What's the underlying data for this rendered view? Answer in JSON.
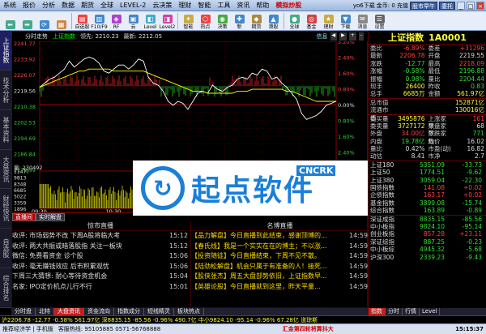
{
  "menu": [
    "系统",
    "报价",
    "分析",
    "数据",
    "期货",
    "全球",
    "LEVEL-2",
    "云决策",
    "理财",
    "智能",
    "工具",
    "资讯",
    "帮助"
  ],
  "menu_hl": "模拟炒股",
  "title_right": {
    "user": "yo6下载",
    "gold": "金币: 0 充值",
    "switch": "股市早午",
    "service": "委托"
  },
  "toolbar": [
    {
      "icon": "⬅",
      "label": ""
    },
    {
      "icon": "➡",
      "label": ""
    },
    {
      "icon": "⟳",
      "label": ""
    },
    {
      "icon": "▦",
      "label": ""
    },
    {
      "icon": "▤",
      "label": "自选股",
      "red": false
    },
    {
      "icon": "▥",
      "label": "F10/F9"
    },
    {
      "icon": "◈",
      "label": "RF"
    },
    {
      "icon": "▣",
      "label": "云"
    },
    {
      "icon": "◧",
      "label": "Level"
    },
    {
      "icon": "◨",
      "label": "Level2"
    },
    {
      "icon": "✦",
      "label": "智能"
    },
    {
      "icon": "⬡",
      "label": "热点"
    },
    {
      "icon": "◉",
      "label": "决策"
    },
    {
      "icon": "✚",
      "label": "新"
    },
    {
      "icon": "◆",
      "label": "期货"
    },
    {
      "icon": "▲",
      "label": "港股"
    },
    {
      "icon": "●",
      "label": "全球"
    },
    {
      "icon": "◎",
      "label": "基金"
    },
    {
      "icon": "★",
      "label": "理财"
    },
    {
      "icon": "▼",
      "label": "下载"
    },
    {
      "icon": "✉",
      "label": "消息"
    },
    {
      "icon": "☰",
      "label": "设置"
    }
  ],
  "sidetabs": [
    "上证指数",
    "技术分析",
    "基本资料",
    "大盘资讯",
    "财经快讯",
    "自选股",
    "综合排名"
  ],
  "chart_info": {
    "label1": "分时走势",
    "label2": "上证指数",
    "label3": "领先: 2210.23",
    "label4": "最新: 2212.05",
    "right": "信息"
  },
  "chart_data": {
    "type": "line",
    "title": "分时走势",
    "y_left_ticks": [
      "2241.77",
      "2233.92",
      "2226.07",
      "2219.56",
      "2210.38",
      "2202.53",
      "2194.69",
      "2186.84",
      "2178.99"
    ],
    "y_right_ticks": [
      "3.20%",
      "2.80%",
      "2.40%",
      "2.00%",
      "1.60%",
      "1.20%",
      "0.80%",
      "0.40%",
      "0.00%",
      "0.40%",
      "0.80%",
      "1.20%",
      "1.60%",
      "2.00%",
      "2.40%",
      "2.80%",
      "3.20%"
    ],
    "x_ticks": [
      "09:30",
      "10:30",
      "11:30",
      "13:00",
      "14:00",
      "15:00"
    ],
    "base": 2219.56,
    "vol_label": "量: 230492",
    "vol_ticks": [
      "11477",
      "9813",
      "8348",
      "6685",
      "5022",
      "3359",
      "1896"
    ],
    "index_line": [
      2219,
      2221,
      2223,
      2224,
      2226,
      2228,
      2232,
      2229,
      2231,
      2233,
      2234,
      2233,
      2231,
      2227,
      2226,
      2228,
      2230,
      2230,
      2228,
      2230,
      2233,
      2232,
      2224,
      2221,
      2220,
      2217,
      2212,
      2210,
      2212,
      2211,
      2208,
      2212,
      2216,
      2217,
      2216,
      2220,
      2218,
      2217,
      2219,
      2220,
      2223,
      2224,
      2223,
      2226,
      2225,
      2228,
      2227,
      2223,
      2224,
      2221,
      2219,
      2216,
      2213,
      2206,
      2203,
      2204,
      2205,
      2207,
      2210,
      2211,
      2212
    ],
    "avg_line": [
      2219,
      2220,
      2221,
      2222,
      2223,
      2224,
      2225,
      2226,
      2227,
      2227,
      2228,
      2228,
      2228,
      2228,
      2228,
      2227,
      2227,
      2227,
      2227,
      2227,
      2227,
      2227,
      2226,
      2225,
      2224,
      2223,
      2222,
      2221,
      2220,
      2219,
      2218,
      2217,
      2217,
      2217,
      2216,
      2216,
      2216,
      2216,
      2216,
      2216,
      2217,
      2217,
      2217,
      2218,
      2218,
      2218,
      2218,
      2218,
      2218,
      2218,
      2217,
      2217,
      2216,
      2215,
      2214,
      2213,
      2212,
      2212,
      2212,
      2212,
      2212
    ]
  },
  "news_tabs": [
    "直播间",
    "实时解盘"
  ],
  "news_left_title": "惊市直播",
  "news_right_title": "名博直播",
  "news_left": [
    {
      "t": "收评: 市场弱势不改 下周A股将临大考",
      "tm": "15:12"
    },
    {
      "t": "收评: 两大共振或暗落股指 关注一板块",
      "tm": "15:12"
    },
    {
      "t": "微信: 免费看资金 诊个股",
      "tm": "15:06"
    },
    {
      "t": "收评: 毫无赚钱效应 后市积累观忧",
      "tm": "15:06"
    },
    {
      "t": "下周三大猜想: 耐心等待资金机会",
      "tm": "15:04"
    },
    {
      "t": "名家: IPO定价机点儿行不行",
      "tm": "15:01"
    }
  ],
  "news_right": [
    {
      "t": "【品力解盘】今日直播到此结束，感谢顶博的...",
      "tm": "14:59"
    },
    {
      "t": "【春氏线】我是一个实实在在的博主；不以涨...",
      "tm": "14:59"
    },
    {
      "t": "【投资随徒】今日直播结束，下周不见不散。",
      "tm": "14:59"
    },
    {
      "t": "【陆劲松解盘】机会只属于有准备的人！接死...",
      "tm": "14:59"
    },
    {
      "t": "【股侠张杰】周五大盘部势依旧，上证指数早...",
      "tm": "14:59"
    },
    {
      "t": "【英雄论股】今日直播就到这里，昨天平量...",
      "tm": "14:59"
    }
  ],
  "bottom_tabs": [
    "分时盘",
    "北特",
    "大盘资讯",
    "资金流向",
    "指数成分",
    "短线精灵",
    "板块热点"
  ],
  "quote": {
    "name": "上证指数",
    "code": "1A0001",
    "rows": [
      {
        "l": "委比",
        "v": "-6.89%",
        "l2": "委差",
        "v2": "+31296",
        "vc": "red",
        "v2c": "red"
      },
      {
        "l": "最新",
        "v": "2206.78",
        "l2": "开盘",
        "v2": "2219.55",
        "vc": "red",
        "v2c": "w"
      },
      {
        "l": "涨跌",
        "v": "-12.77",
        "l2": "最高",
        "v2": "2218.09",
        "vc": "grn",
        "v2c": "red"
      },
      {
        "l": "涨幅",
        "v": "-0.58%",
        "l2": "最低",
        "v2": "2196.88",
        "vc": "grn",
        "v2c": "grn"
      },
      {
        "l": "振幅",
        "v": "0.98%",
        "l2": "量比",
        "v2": "2204.44",
        "vc": "grn",
        "v2c": "grn"
      },
      {
        "l": "现手",
        "v": "26400",
        "l2": "昨收",
        "v2": "0.83",
        "vc": "yel",
        "v2c": "grn"
      },
      {
        "l": "总手",
        "v": "6685万",
        "l2": "金额",
        "v2": "561.97亿",
        "vc": "yel",
        "v2c": "yel"
      }
    ],
    "rows2": [
      {
        "l": "总市值",
        "v": "",
        "l2": "",
        "v2": "152871亿",
        "vc": "w",
        "v2c": "yel"
      },
      {
        "l": "流通市值",
        "v": "",
        "l2": "",
        "v2": "130016亿",
        "vc": "w",
        "v2c": "yel"
      }
    ],
    "rows3": [
      {
        "l": "委买量",
        "v": "3495876",
        "l2": "上涨家数",
        "v2": "161",
        "vc": "yel",
        "v2c": "red"
      },
      {
        "l": "委卖量",
        "v": "3727172",
        "l2": "平盘家数",
        "v2": "68",
        "vc": "yel",
        "v2c": "w"
      },
      {
        "l": "外盘",
        "v": "34.00亿",
        "l2": "下跌家数",
        "v2": "771",
        "vc": "red",
        "v2c": "grn"
      },
      {
        "l": "内盘",
        "v": "19.78亿",
        "l2": "均价",
        "v2": "16.02",
        "vc": "grn",
        "v2c": "w"
      },
      {
        "l": "量比",
        "v": "0.42%",
        "l2": "市盈(动)",
        "v2": "16.82",
        "vc": "w",
        "v2c": "w"
      },
      {
        "l": "动估",
        "v": "8.41",
        "l2": "市净",
        "v2": "2.7",
        "vc": "w",
        "v2c": "w"
      }
    ],
    "table": [
      {
        "n": "上证180",
        "p": "5351.09",
        "c": "-33.73"
      },
      {
        "n": "上证50",
        "p": "1774.51",
        "c": "-9.62"
      },
      {
        "n": "上证380",
        "p": "3059.04",
        "c": "-22.30"
      },
      {
        "n": "国债指数",
        "p": "141.08",
        "c": "+0.02"
      },
      {
        "n": "企债指数",
        "p": "163.17",
        "c": "+0.02"
      },
      {
        "n": "基金指数",
        "p": "3899.08",
        "c": "-15.74"
      },
      {
        "n": "综合指数",
        "p": "163.89",
        "c": "-0.89"
      }
    ],
    "table2": [
      {
        "n": "深证成指",
        "p": "8835.15",
        "c": "-85.56"
      },
      {
        "n": "中小板指",
        "p": "9824.10",
        "c": "-95.14"
      },
      {
        "n": "创业板指",
        "p": "857.28",
        "c": "+23.11"
      },
      {
        "n": "深证综指",
        "p": "887.25",
        "c": "-0.23"
      },
      {
        "n": "中小板综",
        "p": "4945.32",
        "c": "-5.68"
      },
      {
        "n": "沪深300",
        "p": "2339.23",
        "c": "-9.43"
      }
    ],
    "rtabs": [
      "指数",
      "分时",
      "行情",
      "Level"
    ]
  },
  "status": "沪2206.78 -12.77 -0.58% 561.97亿 深8835.15 -85.56 -0.96% 490.7亿 中小9824.10 -95.14 -0.96% 67.28亿 道琼斯",
  "bottombar": {
    "left": "推荐经济学 | 手机版",
    "service": "客服热线: 95105885 0571-56768888",
    "center": "汇金第四轮将算抖大",
    "clock": "15:15:37"
  },
  "watermark": {
    "text": "起点软件",
    "sub": "CNCRK"
  }
}
